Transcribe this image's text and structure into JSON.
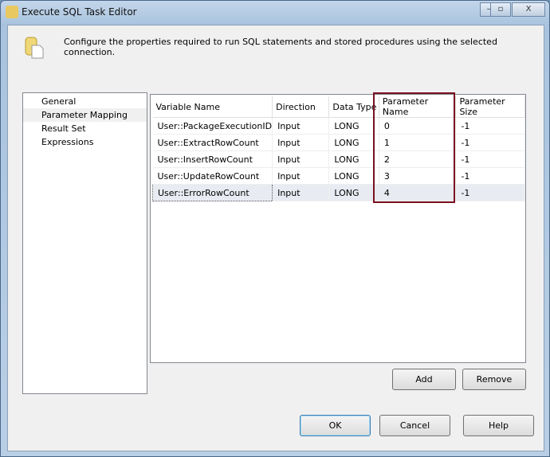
{
  "window": {
    "title": "Execute SQL Task Editor",
    "minimize": "–",
    "maximize": "▫",
    "close": "X"
  },
  "description": "Configure the properties required to run SQL statements and stored procedures using the selected connection.",
  "nav": [
    "General",
    "Parameter Mapping",
    "Result Set",
    "Expressions"
  ],
  "grid": {
    "headers": [
      "Variable Name",
      "Direction",
      "Data Type",
      "Parameter Name",
      "Parameter Size"
    ],
    "rows": [
      [
        "User::PackageExecutionID",
        "Input",
        "LONG",
        "0",
        "-1"
      ],
      [
        "User::ExtractRowCount",
        "Input",
        "LONG",
        "1",
        "-1"
      ],
      [
        "User::InsertRowCount",
        "Input",
        "LONG",
        "2",
        "-1"
      ],
      [
        "User::UpdateRowCount",
        "Input",
        "LONG",
        "3",
        "-1"
      ],
      [
        "User::ErrorRowCount",
        "Input",
        "LONG",
        "4",
        "-1"
      ]
    ]
  },
  "buttons": {
    "add": "Add",
    "remove": "Remove",
    "ok": "OK",
    "cancel": "Cancel",
    "help": "Help"
  },
  "colors": {
    "highlight": "#7a1020"
  }
}
